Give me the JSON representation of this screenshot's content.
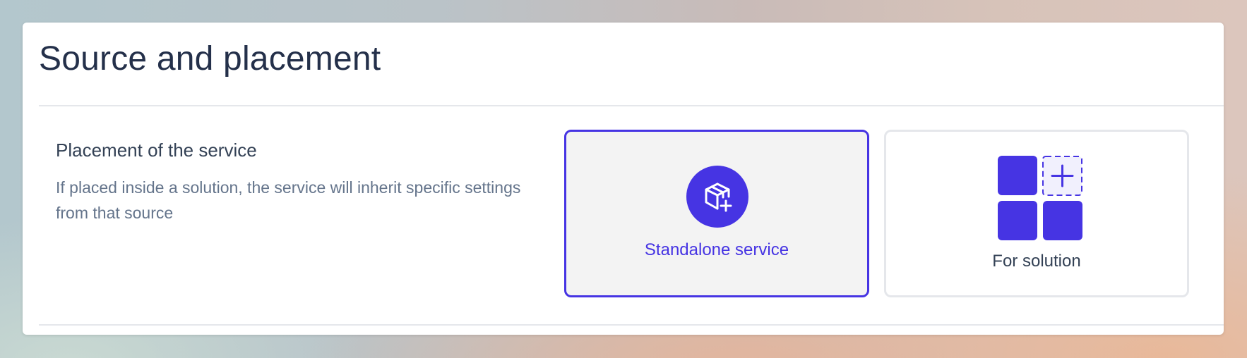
{
  "page": {
    "title": "Source and placement"
  },
  "placement": {
    "heading": "Placement of the service",
    "description": "If placed inside a solution, the service will inherit specific settings from that source",
    "options": [
      {
        "label": "Standalone service",
        "icon": "box-plus-icon",
        "selected": true
      },
      {
        "label": "For solution",
        "icon": "grid-plus-icon",
        "selected": false
      }
    ]
  },
  "colors": {
    "accent": "#4634e3",
    "selected_bg": "#f3f3f3",
    "border": "#e5e7eb",
    "title": "#24304a",
    "muted": "#64748b"
  }
}
